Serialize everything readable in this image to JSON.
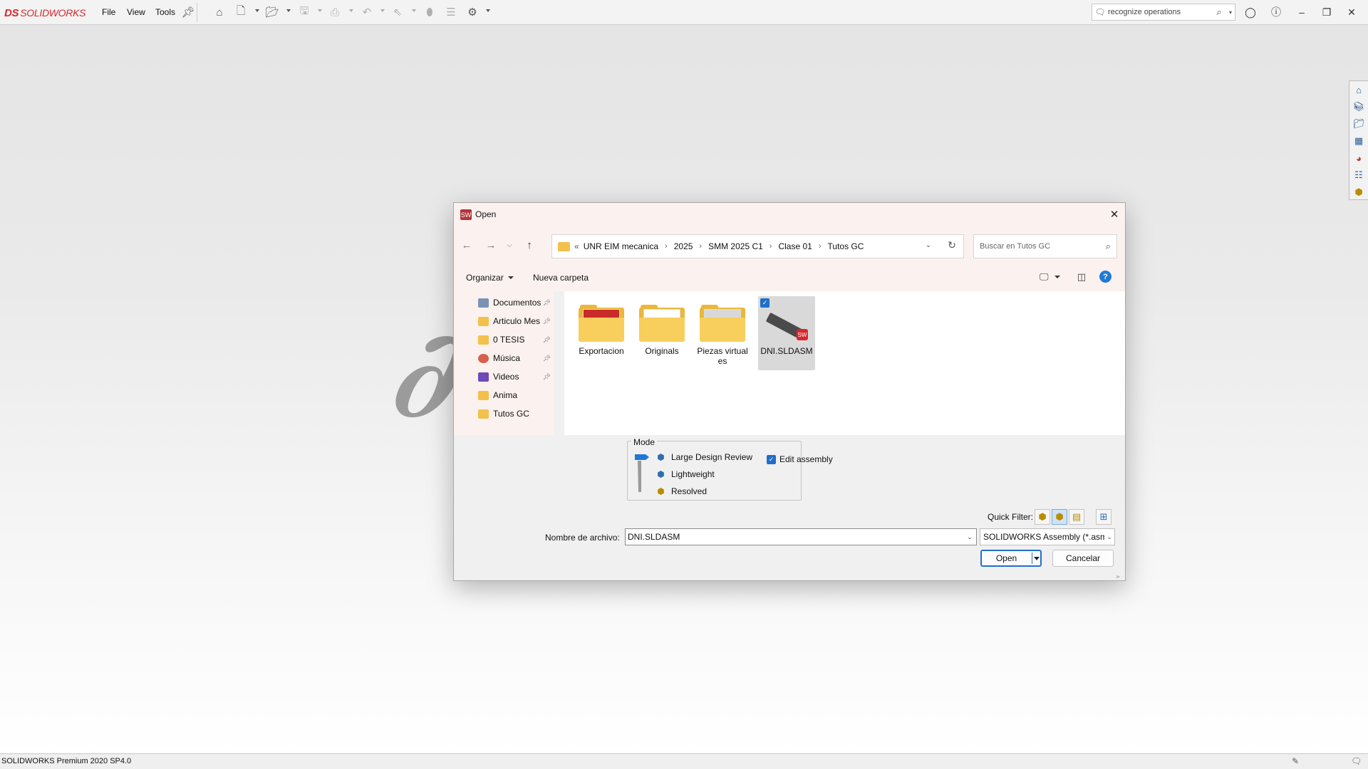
{
  "app": {
    "brand_prefix": "DS",
    "brand_name": "SOLIDWORKS",
    "menus": [
      "File",
      "View",
      "Tools"
    ],
    "search_placeholder": "recognize operations",
    "status_text": "SOLIDWORKS Premium 2020 SP4.0"
  },
  "dialog": {
    "title": "Open",
    "breadcrumb_prefix": "«",
    "breadcrumb": [
      "UNR EIM mecanica",
      "2025",
      "SMM 2025 C1",
      "Clase 01",
      "Tutos GC"
    ],
    "search_placeholder": "Buscar en Tutos GC",
    "organize_label": "Organizar",
    "new_folder_label": "Nueva carpeta",
    "help_label": "?",
    "nav_items": [
      {
        "label": "Documentos",
        "icon": "document-icon",
        "color": "#7a93b5",
        "pinned": true
      },
      {
        "label": "Articulo Mes",
        "icon": "folder-icon",
        "color": "#f4c04c",
        "pinned": true
      },
      {
        "label": "0 TESIS",
        "icon": "folder-icon",
        "color": "#f4c04c",
        "pinned": true
      },
      {
        "label": "Música",
        "icon": "music-icon",
        "color": "#d85f4e",
        "pinned": true
      },
      {
        "label": "Videos",
        "icon": "video-icon",
        "color": "#7048b8",
        "pinned": true
      },
      {
        "label": "Anima",
        "icon": "folder-icon",
        "color": "#f4c04c",
        "pinned": false
      },
      {
        "label": "Tutos GC",
        "icon": "folder-icon",
        "color": "#f4c04c",
        "pinned": false
      }
    ],
    "files": [
      {
        "label": "Exportacion",
        "type": "folder"
      },
      {
        "label": "Originals",
        "type": "folder"
      },
      {
        "label": "Piezas virtuales",
        "type": "folder"
      },
      {
        "label": "DNI.SLDASM",
        "type": "assembly",
        "selected": true
      }
    ],
    "mode": {
      "legend": "Mode",
      "options": [
        "Large Design Review",
        "Lightweight",
        "Resolved"
      ],
      "selected": "Large Design Review",
      "edit_assembly_label": "Edit assembly",
      "edit_assembly_checked": true
    },
    "quick_filter_label": "Quick Filter:",
    "filename_label": "Nombre de archivo:",
    "filename_value": "DNI.SLDASM",
    "filetype_value": "SOLIDWORKS Assembly (*.asm;",
    "open_label": "Open",
    "cancel_label": "Cancelar"
  },
  "colors": {
    "brand_red": "#d8262c",
    "accent_blue": "#1f6fc9",
    "folder_yellow": "#f4c04c"
  }
}
